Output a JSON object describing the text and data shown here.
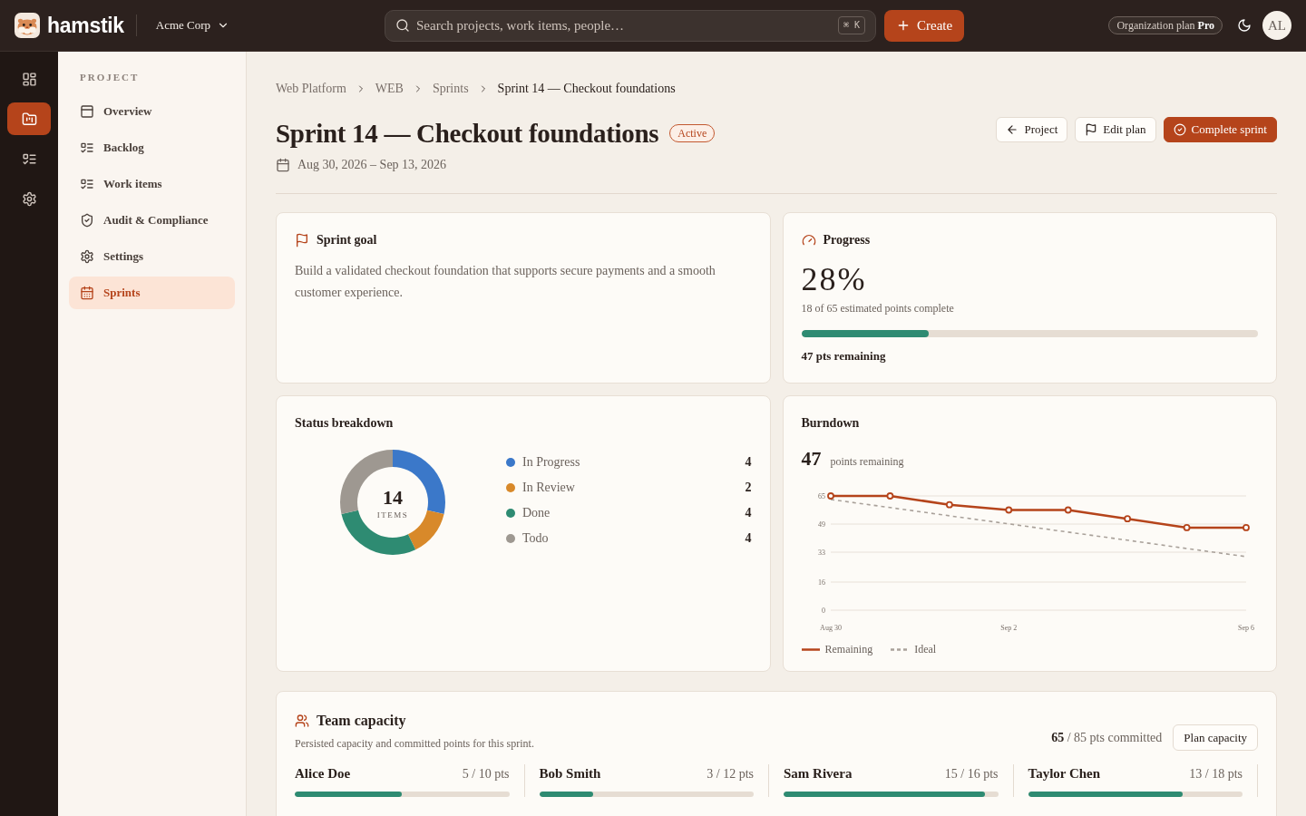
{
  "topbar": {
    "brand": "hamstik",
    "workspace": "Acme Corp",
    "search": {
      "placeholder": "Search projects, work items, people…",
      "shortcut": "⌘ K"
    },
    "create_button": "Create",
    "plan": "Organization plan **Pro**",
    "avatar": "AL"
  },
  "rail": [
    {
      "selected": false
    },
    {
      "selected": true
    },
    {
      "selected": false
    },
    {
      "selected": false
    }
  ],
  "sidebar": {
    "heading": "PROJECT",
    "items": [
      {
        "label": "Overview",
        "selected": false
      },
      {
        "label": "Backlog",
        "selected": false
      },
      {
        "label": "Work items",
        "selected": false
      },
      {
        "label": "Audit & Compliance",
        "selected": false
      },
      {
        "label": "Settings",
        "selected": false
      },
      {
        "label": "Sprints",
        "selected": true
      }
    ]
  },
  "breadcrumb": [
    {
      "label": "Web Platform",
      "current": false
    },
    {
      "label": "WEB",
      "current": false
    },
    {
      "label": "Sprints",
      "current": false
    },
    {
      "label": "Sprint 14 — Checkout foundations",
      "current": true
    }
  ],
  "header": {
    "title": "Sprint 14 — Checkout foundations",
    "status": "Active",
    "dates": "Aug 30, 2026 – Sep 13, 2026",
    "actions": [
      {
        "label": "Project",
        "kind": "back"
      },
      {
        "label": "Edit plan",
        "kind": "edit"
      },
      {
        "label": "Complete sprint",
        "kind": "primary"
      }
    ]
  },
  "sprint_goal": {
    "title": "Sprint goal",
    "text": "Build a validated checkout foundation that supports secure payments and a smooth customer experience."
  },
  "progress": {
    "title": "Progress",
    "percent": "28%",
    "caption": "18 of 65 estimated points complete",
    "level": 0.28,
    "remaining": "47 pts remaining"
  },
  "status_breakdown": {
    "title": "Status breakdown",
    "total": "14",
    "total_label": "ITEMS",
    "chart_data": {
      "type": "donut",
      "values": [
        28.57,
        14.29,
        28.57,
        28.57
      ]
    },
    "legend": [
      {
        "label": "In Progress",
        "count": "4",
        "color": "#3b78c9"
      },
      {
        "label": "In Review",
        "count": "2",
        "color": "#d8892a"
      },
      {
        "label": "Done",
        "count": "4",
        "color": "#2e8b72"
      },
      {
        "label": "Todo",
        "count": "4",
        "color": "#9e9891"
      }
    ]
  },
  "burndown": {
    "title": "Burndown",
    "value": "47",
    "value_label": "points remaining",
    "chart_data": {
      "type": "line",
      "categories": [
        "Aug 30",
        null,
        null,
        "Sep 2",
        null,
        null,
        null,
        "Sep 6"
      ],
      "ylim": [
        0,
        65
      ],
      "yticks": [
        0,
        16,
        33,
        49,
        65
      ],
      "grid": true,
      "series": [
        {
          "name": "Remaining",
          "color": "#b5441b",
          "line_style": "solid",
          "marker": "circle",
          "values": [
            65,
            65,
            60,
            57,
            57,
            52,
            47,
            47
          ]
        },
        {
          "name": "Ideal",
          "color": "#a9a19a",
          "line_style": "dashed",
          "values": [
            63,
            58.4,
            53.7,
            49.1,
            44.4,
            39.8,
            35.1,
            30.5
          ]
        }
      ]
    }
  },
  "team_capacity": {
    "title": "Team capacity",
    "subtitle": "Persisted capacity and committed points for this sprint.",
    "summary": "**65** / 85 pts committed",
    "button": "Plan capacity",
    "members": [
      {
        "name": "Alice Doe",
        "points": "5 / 10 pts",
        "level": 0.5
      },
      {
        "name": "Bob Smith",
        "points": "3 / 12 pts",
        "level": 0.25
      },
      {
        "name": "Sam Rivera",
        "points": "15 / 16 pts",
        "level": 0.9375
      },
      {
        "name": "Taylor Chen",
        "points": "13 / 18 pts",
        "level": 0.722
      }
    ]
  }
}
